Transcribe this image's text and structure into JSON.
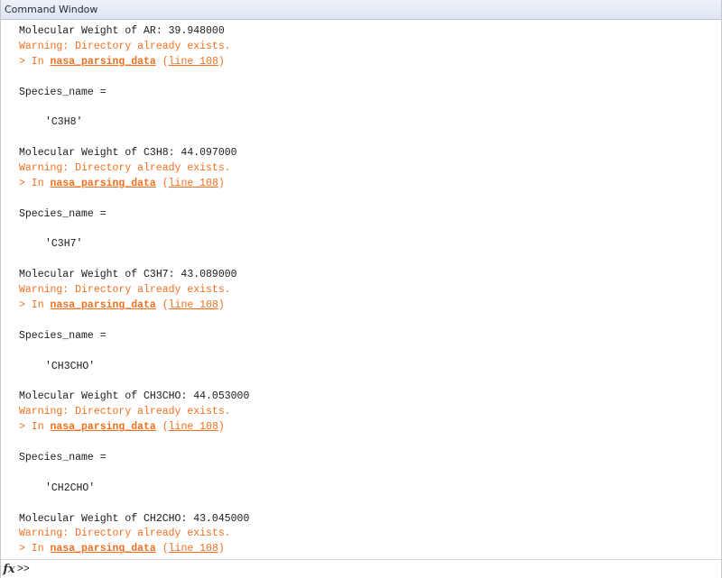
{
  "window": {
    "title": "Command Window"
  },
  "output": {
    "lines": [
      {
        "kind": "text",
        "text": "Molecular Weight of AR: 39.948000"
      },
      {
        "kind": "warn",
        "text": "Warning: Directory already exists."
      },
      {
        "kind": "trace",
        "prefix": "> In ",
        "fn": "nasa_parsing_data",
        "open": " (",
        "line": "line 108",
        "close": ")"
      },
      {
        "kind": "blank"
      },
      {
        "kind": "text",
        "text": "Species_name ="
      },
      {
        "kind": "blank"
      },
      {
        "kind": "value",
        "text": "'C3H8'"
      },
      {
        "kind": "blank"
      },
      {
        "kind": "text",
        "text": "Molecular Weight of C3H8: 44.097000"
      },
      {
        "kind": "warn",
        "text": "Warning: Directory already exists."
      },
      {
        "kind": "trace",
        "prefix": "> In ",
        "fn": "nasa_parsing_data",
        "open": " (",
        "line": "line 108",
        "close": ")"
      },
      {
        "kind": "blank"
      },
      {
        "kind": "text",
        "text": "Species_name ="
      },
      {
        "kind": "blank"
      },
      {
        "kind": "value",
        "text": "'C3H7'"
      },
      {
        "kind": "blank"
      },
      {
        "kind": "text",
        "text": "Molecular Weight of C3H7: 43.089000"
      },
      {
        "kind": "warn",
        "text": "Warning: Directory already exists."
      },
      {
        "kind": "trace",
        "prefix": "> In ",
        "fn": "nasa_parsing_data",
        "open": " (",
        "line": "line 108",
        "close": ")"
      },
      {
        "kind": "blank"
      },
      {
        "kind": "text",
        "text": "Species_name ="
      },
      {
        "kind": "blank"
      },
      {
        "kind": "value",
        "text": "'CH3CHO'"
      },
      {
        "kind": "blank"
      },
      {
        "kind": "text",
        "text": "Molecular Weight of CH3CHO: 44.053000"
      },
      {
        "kind": "warn",
        "text": "Warning: Directory already exists."
      },
      {
        "kind": "trace",
        "prefix": "> In ",
        "fn": "nasa_parsing_data",
        "open": " (",
        "line": "line 108",
        "close": ")"
      },
      {
        "kind": "blank"
      },
      {
        "kind": "text",
        "text": "Species_name ="
      },
      {
        "kind": "blank"
      },
      {
        "kind": "value",
        "text": "'CH2CHO'"
      },
      {
        "kind": "blank"
      },
      {
        "kind": "text",
        "text": "Molecular Weight of CH2CHO: 43.045000"
      },
      {
        "kind": "warn",
        "text": "Warning: Directory already exists."
      },
      {
        "kind": "trace",
        "prefix": "> In ",
        "fn": "nasa_parsing_data",
        "open": " (",
        "line": "line 108",
        "close": ")"
      }
    ]
  },
  "prompt": {
    "fx_label": "fx",
    "fx_icon": "function-browser-icon",
    "symbol": ">>",
    "input_value": ""
  },
  "colors": {
    "warning": "#f07020",
    "text": "#1a1a1a"
  }
}
